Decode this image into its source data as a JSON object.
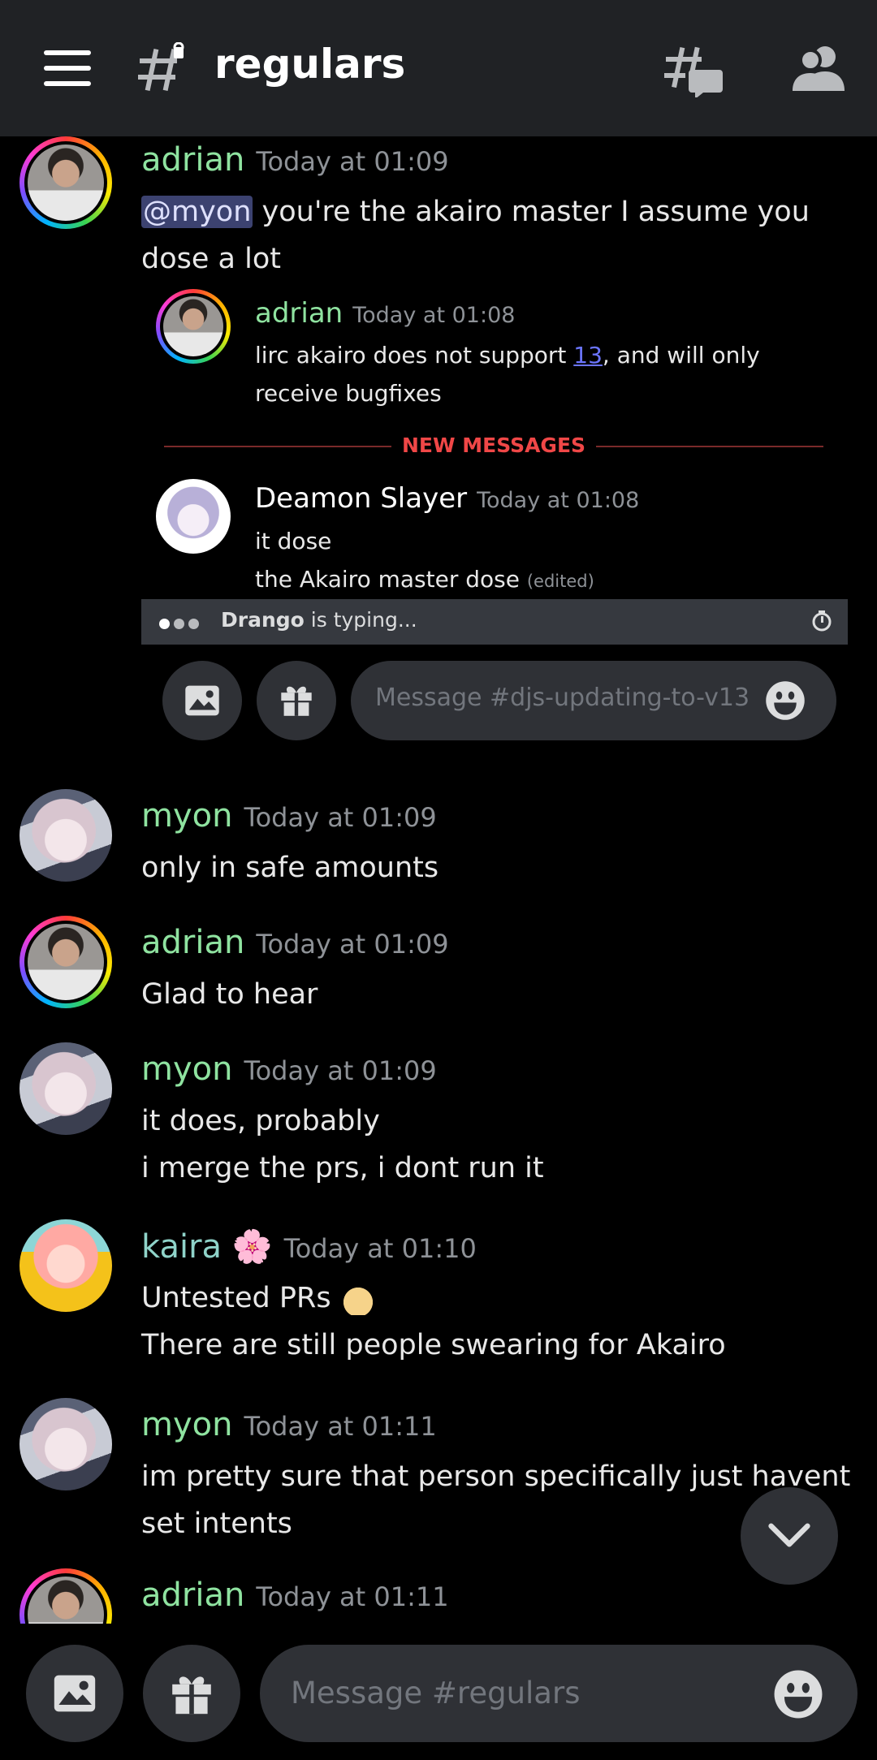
{
  "header": {
    "channel_name": "regulars",
    "icons": [
      "hamburger-menu-icon",
      "text-channel-icon",
      "threads-icon",
      "members-icon"
    ]
  },
  "messages": [
    {
      "author": "adrian",
      "time": "Today at 01:09",
      "mention": "@myon",
      "text": " you're the akairo master I assume you dose a lot"
    },
    {
      "author": "myon",
      "time": "Today at 01:09",
      "lines": [
        "only in safe amounts"
      ]
    },
    {
      "author": "adrian",
      "time": "Today at 01:09",
      "lines": [
        "Glad to hear"
      ]
    },
    {
      "author": "myon",
      "time": "Today at 01:09",
      "lines": [
        "it does, probably",
        "i merge the prs, i dont run it"
      ]
    },
    {
      "author": "kaira",
      "author_emoji": "🌸",
      "time": "Today at 01:10",
      "lines": [
        "Untested PRs",
        "There are still people swearing for Akairo"
      ]
    },
    {
      "author": "myon",
      "time": "Today at 01:11",
      "lines": [
        "im pretty sure that person specifically just havent set intents"
      ]
    },
    {
      "author": "adrian",
      "time": "Today at 01:11"
    }
  ],
  "embed": {
    "msg1": {
      "author": "adrian",
      "time": "Today at 01:08",
      "text_before": "lirc akairo does not support ",
      "link": "13",
      "text_after": ", and will only receive bugfixes"
    },
    "divider": "NEW MESSAGES",
    "msg2": {
      "author": "Deamon Slayer",
      "time": "Today at 01:08",
      "line1": "it dose",
      "line2": "the Akairo master dose",
      "edited": "(edited)"
    },
    "typing": {
      "user": "Drango",
      "text": " is typing..."
    },
    "composer_placeholder": "Message #djs-updating-to-v13"
  },
  "composer": {
    "placeholder": "Message #regulars"
  },
  "colors": {
    "username_green": "#8fe3a0",
    "kaira_teal": "#8fd3c9",
    "new_messages_red": "#f04747",
    "mention_bg": "#3c4270",
    "link": "#6b75ff"
  }
}
